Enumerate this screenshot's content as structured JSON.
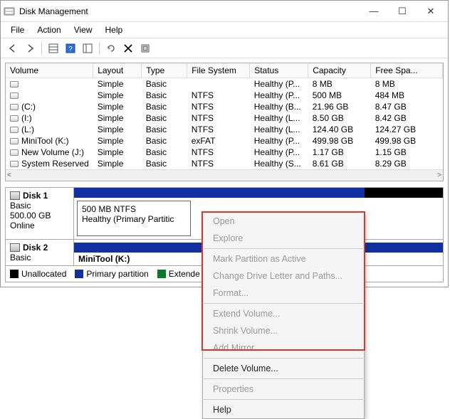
{
  "window": {
    "title": "Disk Management",
    "controls": {
      "min": "—",
      "max": "☐",
      "close": "✕"
    }
  },
  "menu": {
    "file": "File",
    "action": "Action",
    "view": "View",
    "help": "Help"
  },
  "columns": {
    "volume": "Volume",
    "layout": "Layout",
    "type": "Type",
    "filesystem": "File System",
    "status": "Status",
    "capacity": "Capacity",
    "freespace": "Free Spa..."
  },
  "volumes": [
    {
      "name": "",
      "layout": "Simple",
      "type": "Basic",
      "fs": "",
      "status": "Healthy (P...",
      "cap": "8 MB",
      "free": "8 MB"
    },
    {
      "name": "",
      "layout": "Simple",
      "type": "Basic",
      "fs": "NTFS",
      "status": "Healthy (P...",
      "cap": "500 MB",
      "free": "484 MB"
    },
    {
      "name": "(C:)",
      "layout": "Simple",
      "type": "Basic",
      "fs": "NTFS",
      "status": "Healthy (B...",
      "cap": "21.96 GB",
      "free": "8.47 GB"
    },
    {
      "name": "(I:)",
      "layout": "Simple",
      "type": "Basic",
      "fs": "NTFS",
      "status": "Healthy (L...",
      "cap": "8.50 GB",
      "free": "8.42 GB"
    },
    {
      "name": "(L:)",
      "layout": "Simple",
      "type": "Basic",
      "fs": "NTFS",
      "status": "Healthy (L...",
      "cap": "124.40 GB",
      "free": "124.27 GB"
    },
    {
      "name": "MiniTool (K:)",
      "layout": "Simple",
      "type": "Basic",
      "fs": "exFAT",
      "status": "Healthy (P...",
      "cap": "499.98 GB",
      "free": "499.98 GB"
    },
    {
      "name": "New Volume (J:)",
      "layout": "Simple",
      "type": "Basic",
      "fs": "NTFS",
      "status": "Healthy (P...",
      "cap": "1.17 GB",
      "free": "1.15 GB"
    },
    {
      "name": "System Reserved",
      "layout": "Simple",
      "type": "Basic",
      "fs": "NTFS",
      "status": "Healthy (S...",
      "cap": "8.61 GB",
      "free": "8.29 GB"
    }
  ],
  "disks": {
    "d1": {
      "name": "Disk 1",
      "type": "Basic",
      "size": "500.00 GB",
      "state": "Online",
      "part": {
        "line1": "500 MB NTFS",
        "line2": "Healthy (Primary Partitic"
      }
    },
    "d2": {
      "name": "Disk 2",
      "type": "Basic",
      "part": {
        "label": "MiniTool  (K:)"
      }
    }
  },
  "legend": {
    "unalloc": "Unallocated",
    "primary": "Primary partition",
    "extended": "Extende"
  },
  "ctx": {
    "open": "Open",
    "explore": "Explore",
    "mark": "Mark Partition as Active",
    "drive": "Change Drive Letter and Paths...",
    "format": "Format...",
    "extend": "Extend Volume...",
    "shrink": "Shrink Volume...",
    "addmirror": "Add Mirror...",
    "delete": "Delete Volume...",
    "properties": "Properties",
    "help": "Help"
  }
}
